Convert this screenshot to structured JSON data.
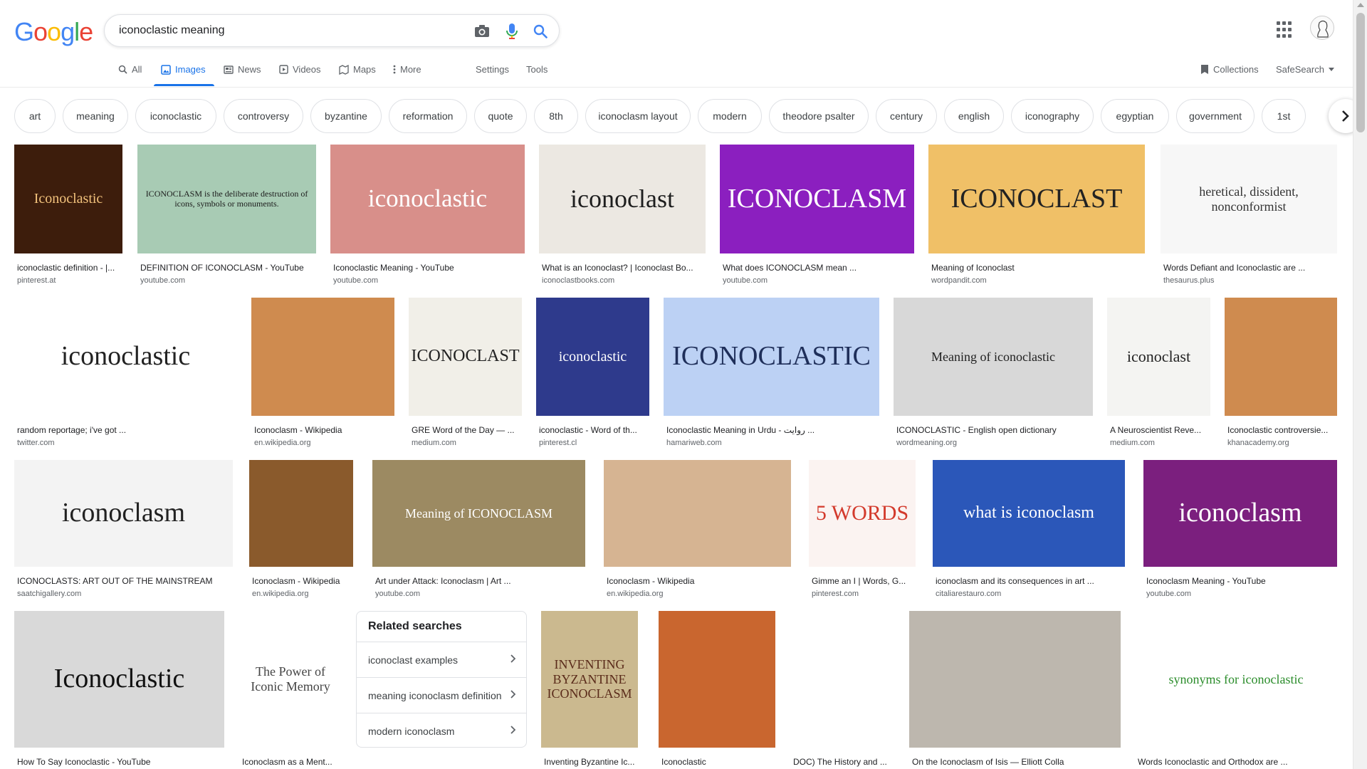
{
  "logo_letters": [
    "G",
    "o",
    "o",
    "g",
    "l",
    "e"
  ],
  "search": {
    "query": "iconoclastic meaning"
  },
  "tabs": {
    "all": "All",
    "images": "Images",
    "news": "News",
    "videos": "Videos",
    "maps": "Maps",
    "more": "More",
    "settings": "Settings",
    "tools": "Tools"
  },
  "header_right": {
    "collections": "Collections",
    "safesearch": "SafeSearch"
  },
  "chips": [
    "art",
    "meaning",
    "iconoclastic",
    "controversy",
    "byzantine",
    "reformation",
    "quote",
    "8th",
    "iconoclasm layout",
    "modern",
    "theodore psalter",
    "century",
    "english",
    "iconography",
    "egyptian",
    "government",
    "1st"
  ],
  "results": [
    {
      "title": "iconoclastic definition - |...",
      "site": "pinterest.at",
      "text": "Iconoclastic",
      "bg": "#3d1d0c",
      "fg": "#f2c27c"
    },
    {
      "title": "DEFINITION OF ICONOCLASM - YouTube",
      "site": "youtube.com",
      "text": "ICONOCLASM is the deliberate destruction of icons, symbols or monuments.",
      "bg": "#a8cbb4",
      "fg": "#1c1c1c"
    },
    {
      "title": "Iconoclastic Meaning - YouTube",
      "site": "youtube.com",
      "text": "iconoclastic",
      "bg": "#d88f8a",
      "fg": "#ffffff"
    },
    {
      "title": "What is an Iconoclast? | Iconoclast Bo...",
      "site": "iconoclastbooks.com",
      "text": "iconoclast",
      "bg": "#ece8e2",
      "fg": "#1e1e1e"
    },
    {
      "title": "What does ICONOCLASM mean ...",
      "site": "youtube.com",
      "text": "ICONOCLASM",
      "bg": "#8b1fbf",
      "fg": "#ffffff"
    },
    {
      "title": "Meaning of Iconoclast",
      "site": "wordpandit.com",
      "text": "ICONOCLAST",
      "bg": "#f0c067",
      "fg": "#222222"
    },
    {
      "title": "Words Defiant and Iconoclastic are ...",
      "site": "thesaurus.plus",
      "text": "heretical, dissident, nonconformist",
      "bg": "#f7f7f7",
      "fg": "#333333"
    },
    {
      "title": "random reportage; i've got ...",
      "site": "twitter.com",
      "text": "iconoclastic",
      "bg": "#ffffff",
      "fg": "#222222"
    },
    {
      "title": "Iconoclasm - Wikipedia",
      "site": "en.wikipedia.org",
      "text": "",
      "bg": "#cf8b4f",
      "fg": "#ffffff"
    },
    {
      "title": "GRE Word of the Day — ...",
      "site": "medium.com",
      "text": "ICONOCLAST",
      "bg": "#f1efe8",
      "fg": "#222222"
    },
    {
      "title": "iconoclastic - Word of th...",
      "site": "pinterest.cl",
      "text": "iconoclastic",
      "bg": "#2e3a8c",
      "fg": "#ffffff"
    },
    {
      "title": "Iconoclastic Meaning in Urdu - روایت ...",
      "site": "hamariweb.com",
      "text": "ICONOCLASTIC",
      "bg": "#bcd1f4",
      "fg": "#1f2f5a"
    },
    {
      "title": "ICONOCLASTIC - English open dictionary",
      "site": "wordmeaning.org",
      "text": "Meaning of iconoclastic",
      "bg": "#d8d8d8",
      "fg": "#222222"
    },
    {
      "title": "A Neuroscientist Reve...",
      "site": "medium.com",
      "text": "iconoclast",
      "bg": "#f4f4f2",
      "fg": "#222222"
    },
    {
      "title": "Iconoclastic controversie...",
      "site": "khanacademy.org",
      "text": "",
      "bg": "#cf8b4f",
      "fg": "#ffffff"
    },
    {
      "title": "ICONOCLASTS: ART OUT OF THE MAINSTREAM",
      "site": "saatchigallery.com",
      "text": "iconoclasm",
      "bg": "#f3f3f3",
      "fg": "#222222"
    },
    {
      "title": "Iconoclasm - Wikipedia",
      "site": "en.wikipedia.org",
      "text": "",
      "bg": "#8a5a2c",
      "fg": "#ffffff"
    },
    {
      "title": "Art under Attack: Iconoclasm | Art ...",
      "site": "youtube.com",
      "text": "Meaning of ICONOCLASM",
      "bg": "#9c8a62",
      "fg": "#ffffff"
    },
    {
      "title": "Iconoclasm - Wikipedia",
      "site": "en.wikipedia.org",
      "text": "",
      "bg": "#d6b492",
      "fg": "#ffffff"
    },
    {
      "title": "Gimme an I | Words, G...",
      "site": "pinterest.com",
      "text": "5 WORDS",
      "bg": "#fbf3f1",
      "fg": "#d33a2c"
    },
    {
      "title": "iconoclasm and its consequences in art ...",
      "site": "citaliarestauro.com",
      "text": "what is iconoclasm",
      "bg": "#2b57b9",
      "fg": "#ffffff"
    },
    {
      "title": "Iconoclasm Meaning - YouTube",
      "site": "youtube.com",
      "text": "iconoclasm",
      "bg": "#7b1f7e",
      "fg": "#ffffff"
    },
    {
      "title": "How To Say Iconoclastic - YouTube",
      "site": "",
      "text": "Iconoclastic",
      "bg": "#d9d9d9",
      "fg": "#111111"
    },
    {
      "title": "Iconoclasm as a Ment...",
      "site": "",
      "text": "The Power of Iconic Memory",
      "bg": "#ffffff",
      "fg": "#444444"
    },
    {
      "title": "Inventing Byzantine Ic...",
      "site": "",
      "text": "INVENTING BYZANTINE ICONOCLASM",
      "bg": "#cbb98f",
      "fg": "#5a2b1a"
    },
    {
      "title": "Iconoclastic",
      "site": "",
      "text": "",
      "bg": "#c9662f",
      "fg": "#ffffff"
    },
    {
      "title": "DOC) The History and ...",
      "site": "",
      "text": "",
      "bg": "#ffffff",
      "fg": "#777777"
    },
    {
      "title": "On the Iconoclasm of Isis — Elliott Colla",
      "site": "",
      "text": "",
      "bg": "#bdb7ae",
      "fg": "#ffffff"
    },
    {
      "title": "Words Iconoclastic and Orthodox are ...",
      "site": "",
      "text": "synonyms for iconoclastic",
      "bg": "#ffffff",
      "fg": "#2a8c2a"
    }
  ],
  "related": {
    "heading": "Related searches",
    "items": [
      "iconoclast examples",
      "meaning iconoclasm definition",
      "modern iconoclasm"
    ]
  },
  "colors": {
    "accent": "#1a73e8",
    "text": "#202124",
    "muted": "#5f6368"
  }
}
